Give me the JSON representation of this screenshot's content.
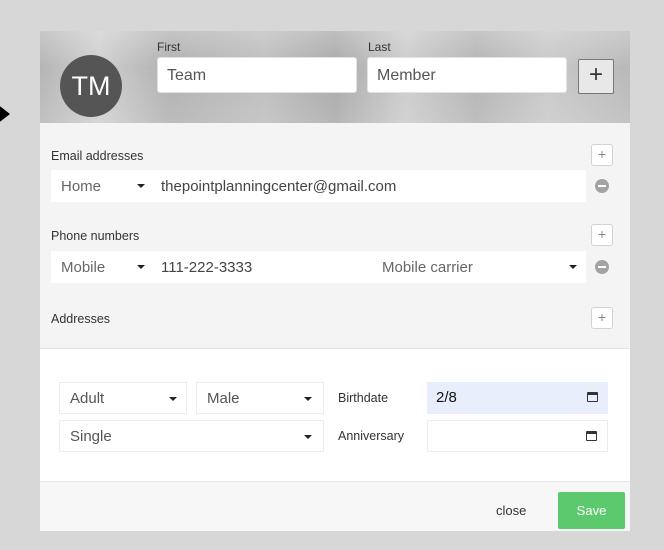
{
  "header": {
    "avatar_initials": "TM",
    "first_label": "First",
    "last_label": "Last",
    "first_value": "Team",
    "last_value": "Member",
    "add_symbol": "+"
  },
  "email": {
    "section_label": "Email addresses",
    "add_symbol": "+",
    "type": "Home",
    "value": "thepointplanningcenter@gmail.com"
  },
  "phone": {
    "section_label": "Phone numbers",
    "add_symbol": "+",
    "type": "Mobile",
    "value": "111-222-3333",
    "carrier_placeholder": "Mobile carrier"
  },
  "addresses": {
    "section_label": "Addresses",
    "add_symbol": "+"
  },
  "details": {
    "age_group": "Adult",
    "gender": "Male",
    "marital_status": "Single",
    "birthdate_label": "Birthdate",
    "birthdate_value": "2/8",
    "anniversary_label": "Anniversary",
    "anniversary_value": ""
  },
  "footer": {
    "close_label": "close",
    "save_label": "Save"
  },
  "colors": {
    "save_button": "#5cc96f",
    "avatar": "#555555",
    "birthdate_highlight": "#e8eefc"
  }
}
